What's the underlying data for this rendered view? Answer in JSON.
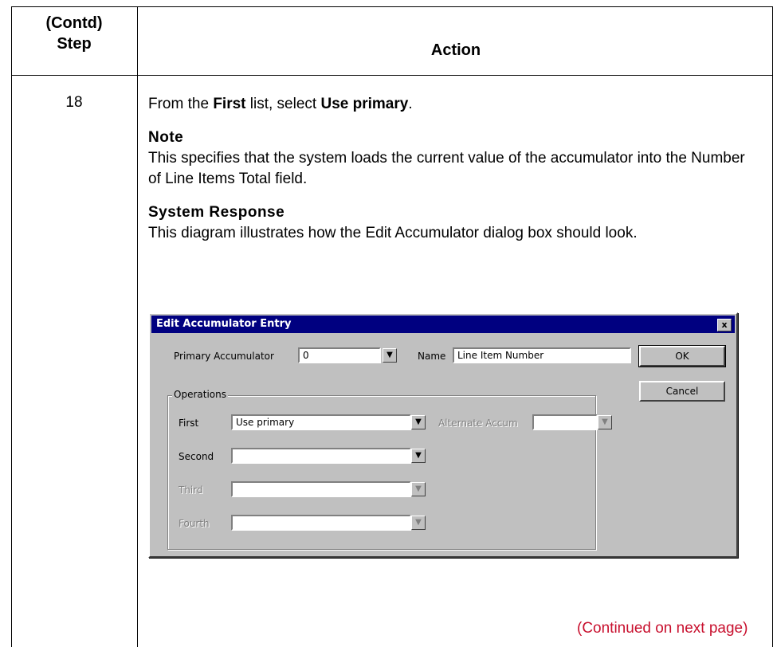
{
  "table": {
    "step_header_line1": "(Contd)",
    "step_header_line2": "Step",
    "action_header": "Action"
  },
  "step": {
    "number": "18",
    "intro_prefix": "From the ",
    "intro_first": "First",
    "intro_mid": " list, select ",
    "intro_value": "Use primary",
    "intro_suffix": ".",
    "note_heading": "Note",
    "note_text": "This specifies that the system loads the current value of the accumulator into the Number of Line Items Total field.",
    "response_heading": "System Response",
    "response_text": "This diagram illustrates how the Edit Accumulator dialog box should look."
  },
  "dialog": {
    "title": "Edit Accumulator Entry",
    "close_glyph": "x",
    "primary_label": "Primary Accumulator",
    "primary_value": "0",
    "name_label": "Name",
    "name_value": "Line Item Number",
    "ok_label": "OK",
    "cancel_label": "Cancel",
    "operations_label": "Operations",
    "first_label": "First",
    "first_value": "Use primary",
    "alternate_label": "Alternate Accum",
    "alternate_value": "",
    "second_label": "Second",
    "second_value": "",
    "third_label": "Third",
    "third_value": "",
    "fourth_label": "Fourth",
    "fourth_value": ""
  },
  "footer": {
    "continued": "(Continued on next page)"
  }
}
